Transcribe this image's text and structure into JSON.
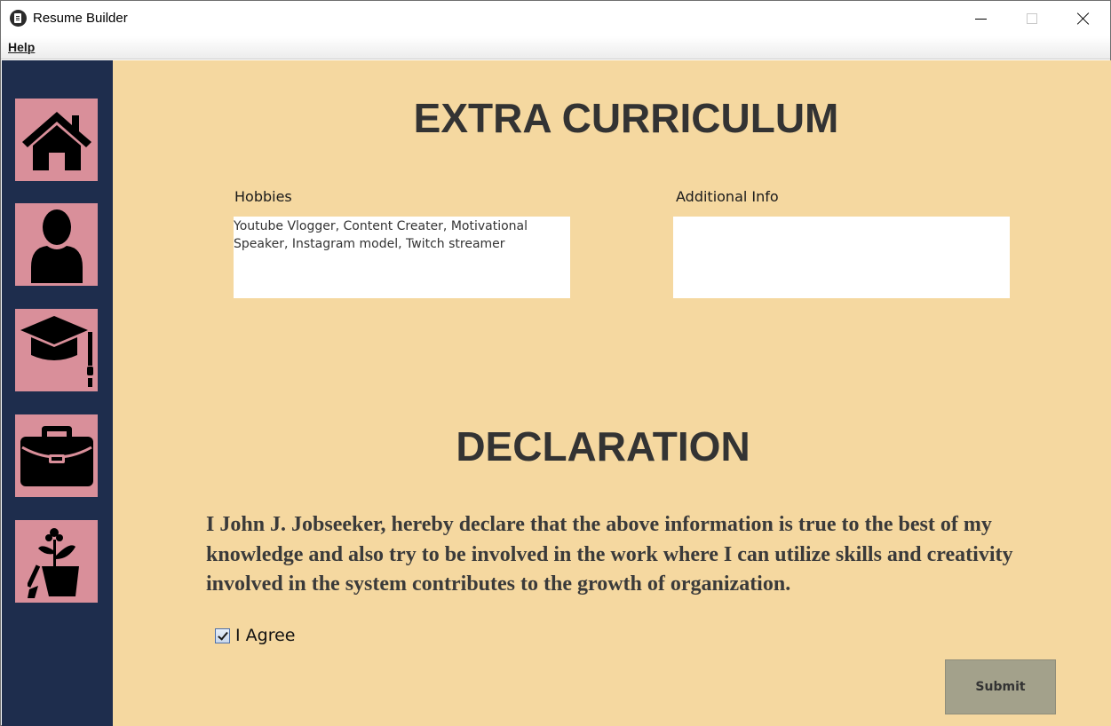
{
  "window": {
    "title": "Resume Builder",
    "controls": {
      "minimize": "minimize-icon",
      "maximize": "maximize-icon",
      "close": "close-icon"
    }
  },
  "menu": {
    "help": "Help"
  },
  "sidebar": {
    "background": "#1e2d4d",
    "button_color": "#d98f9a",
    "items": [
      {
        "icon": "home-icon"
      },
      {
        "icon": "user-icon"
      },
      {
        "icon": "graduation-cap-icon"
      },
      {
        "icon": "briefcase-icon"
      },
      {
        "icon": "plant-shovel-icon"
      }
    ]
  },
  "extra": {
    "heading": "EXTRA CURRICULUM",
    "hobbies_label": "Hobbies",
    "hobbies_value": "Youtube Vlogger, Content Creater, Motivational Speaker, Instagram model, Twitch streamer",
    "info_label": "Additional Info",
    "info_value": ""
  },
  "declaration": {
    "heading": "DECLARATION",
    "text": "I John J. Jobseeker, hereby declare that the above information is true to the best of my knowledge and also try to be involved in the work where I can utilize skills and creativity involved in the system contributes to the growth of organization.",
    "agree_label": "I Agree",
    "agree_checked": true,
    "submit_label": "Submit"
  },
  "colors": {
    "content_bg": "#f5d8a0",
    "heading": "#333333",
    "submit_bg": "#a3a18b"
  }
}
